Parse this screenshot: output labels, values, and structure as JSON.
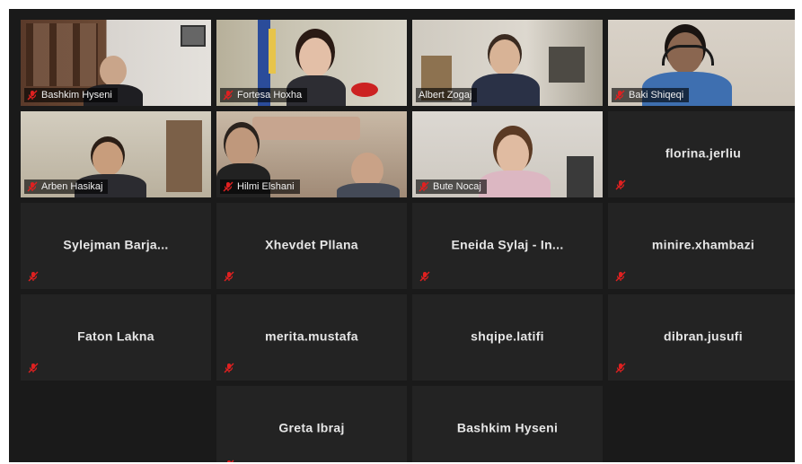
{
  "app": {
    "name": "video-meeting-gallery-view"
  },
  "colors": {
    "background": "#1a1a1a",
    "tile": "#232323",
    "active_speaker_border": "#c8d93a",
    "muted_icon": "#e02020",
    "name_text": "#e6e6e6"
  },
  "participants": {
    "p01": {
      "name": "Bashkim Hyseni",
      "muted": true,
      "video": true
    },
    "p02": {
      "name": "Fortesa Hoxha",
      "muted": true,
      "video": true
    },
    "p03": {
      "name": "Albert Zogaj",
      "muted": false,
      "video": true,
      "active_speaker": true
    },
    "p04": {
      "name": "Baki Shiqeqi",
      "muted": true,
      "video": true
    },
    "p05": {
      "name": "Arben Hasikaj",
      "muted": true,
      "video": true
    },
    "p06": {
      "name": "Hilmi Elshani",
      "muted": true,
      "video": true
    },
    "p07": {
      "name": "Bute Nocaj",
      "muted": true,
      "video": true
    },
    "p08": {
      "name": "florina.jerliu",
      "muted": true,
      "video": false
    },
    "p09": {
      "name": "Sylejman Barja...",
      "muted": true,
      "video": false
    },
    "p10": {
      "name": "Xhevdet Pllana",
      "muted": true,
      "video": false
    },
    "p11": {
      "name": "Eneida Sylaj - In...",
      "muted": true,
      "video": false
    },
    "p12": {
      "name": "minire.xhambazi",
      "muted": true,
      "video": false
    },
    "p13": {
      "name": "Faton Lakna",
      "muted": true,
      "video": false
    },
    "p14": {
      "name": "merita.mustafa",
      "muted": true,
      "video": false
    },
    "p15": {
      "name": "shqipe.latifi",
      "muted": true,
      "video": false
    },
    "p16": {
      "name": "dibran.jusufi",
      "muted": true,
      "video": false
    },
    "p17": {
      "name": "Greta Ibraj",
      "muted": true,
      "video": false
    },
    "p18": {
      "name": "Bashkim Hyseni",
      "muted": true,
      "video": false
    }
  },
  "icons": {
    "muted": "microphone-muted-icon"
  }
}
